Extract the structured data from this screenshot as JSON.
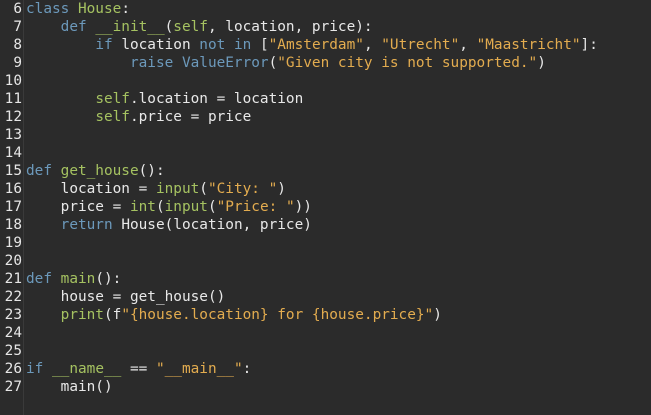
{
  "editor": {
    "lines": [
      {
        "number": "6",
        "tokens": [
          {
            "t": "class ",
            "c": "kw"
          },
          {
            "t": "House",
            "c": "fn"
          },
          {
            "t": ":",
            "c": "plain"
          }
        ]
      },
      {
        "number": "7",
        "tokens": [
          {
            "t": "    ",
            "c": "plain"
          },
          {
            "t": "def ",
            "c": "kw"
          },
          {
            "t": "__init__",
            "c": "fn"
          },
          {
            "t": "(",
            "c": "plain"
          },
          {
            "t": "self",
            "c": "selfkw"
          },
          {
            "t": ", location, price):",
            "c": "plain"
          }
        ]
      },
      {
        "number": "8",
        "tokens": [
          {
            "t": "        ",
            "c": "plain"
          },
          {
            "t": "if ",
            "c": "kw"
          },
          {
            "t": "location ",
            "c": "plain"
          },
          {
            "t": "not in ",
            "c": "kw"
          },
          {
            "t": "[",
            "c": "plain"
          },
          {
            "t": "\"Amsterdam\"",
            "c": "str"
          },
          {
            "t": ", ",
            "c": "plain"
          },
          {
            "t": "\"Utrecht\"",
            "c": "str"
          },
          {
            "t": ", ",
            "c": "plain"
          },
          {
            "t": "\"Maastricht\"",
            "c": "str"
          },
          {
            "t": "]:",
            "c": "plain"
          }
        ]
      },
      {
        "number": "9",
        "tokens": [
          {
            "t": "            ",
            "c": "plain"
          },
          {
            "t": "raise ",
            "c": "kw"
          },
          {
            "t": "ValueError",
            "c": "kw"
          },
          {
            "t": "(",
            "c": "plain"
          },
          {
            "t": "\"Given city is not supported.\"",
            "c": "str"
          },
          {
            "t": ")",
            "c": "plain"
          }
        ]
      },
      {
        "number": "10",
        "tokens": []
      },
      {
        "number": "11",
        "tokens": [
          {
            "t": "        ",
            "c": "plain"
          },
          {
            "t": "self",
            "c": "selfkw"
          },
          {
            "t": ".location = location",
            "c": "plain"
          }
        ]
      },
      {
        "number": "12",
        "tokens": [
          {
            "t": "        ",
            "c": "plain"
          },
          {
            "t": "self",
            "c": "selfkw"
          },
          {
            "t": ".price = price",
            "c": "plain"
          }
        ]
      },
      {
        "number": "13",
        "tokens": []
      },
      {
        "number": "14",
        "tokens": []
      },
      {
        "number": "15",
        "tokens": [
          {
            "t": "def ",
            "c": "kw"
          },
          {
            "t": "get_house",
            "c": "fn"
          },
          {
            "t": "():",
            "c": "plain"
          }
        ]
      },
      {
        "number": "16",
        "tokens": [
          {
            "t": "    location = ",
            "c": "plain"
          },
          {
            "t": "input",
            "c": "builtin"
          },
          {
            "t": "(",
            "c": "plain"
          },
          {
            "t": "\"City: \"",
            "c": "str"
          },
          {
            "t": ")",
            "c": "plain"
          }
        ]
      },
      {
        "number": "17",
        "tokens": [
          {
            "t": "    price = ",
            "c": "plain"
          },
          {
            "t": "int",
            "c": "builtin"
          },
          {
            "t": "(",
            "c": "plain"
          },
          {
            "t": "input",
            "c": "builtin"
          },
          {
            "t": "(",
            "c": "plain"
          },
          {
            "t": "\"Price: \"",
            "c": "str"
          },
          {
            "t": "))",
            "c": "plain"
          }
        ]
      },
      {
        "number": "18",
        "tokens": [
          {
            "t": "    ",
            "c": "plain"
          },
          {
            "t": "return ",
            "c": "kw"
          },
          {
            "t": "House(location, price)",
            "c": "plain"
          }
        ]
      },
      {
        "number": "19",
        "tokens": []
      },
      {
        "number": "20",
        "tokens": []
      },
      {
        "number": "21",
        "tokens": [
          {
            "t": "def ",
            "c": "kw"
          },
          {
            "t": "main",
            "c": "fn"
          },
          {
            "t": "():",
            "c": "plain"
          }
        ]
      },
      {
        "number": "22",
        "tokens": [
          {
            "t": "    house = get_house()",
            "c": "plain"
          }
        ]
      },
      {
        "number": "23",
        "tokens": [
          {
            "t": "    ",
            "c": "plain"
          },
          {
            "t": "print",
            "c": "builtin"
          },
          {
            "t": "(f",
            "c": "plain"
          },
          {
            "t": "\"{house.location} for {house.price}\"",
            "c": "str"
          },
          {
            "t": ")",
            "c": "plain"
          }
        ]
      },
      {
        "number": "24",
        "tokens": []
      },
      {
        "number": "25",
        "tokens": []
      },
      {
        "number": "26",
        "tokens": [
          {
            "t": "if ",
            "c": "kw"
          },
          {
            "t": "__name__",
            "c": "fn"
          },
          {
            "t": " == ",
            "c": "plain"
          },
          {
            "t": "\"__main__\"",
            "c": "str"
          },
          {
            "t": ":",
            "c": "plain"
          }
        ]
      },
      {
        "number": "27",
        "tokens": [
          {
            "t": "    main()",
            "c": "plain"
          }
        ]
      }
    ]
  }
}
